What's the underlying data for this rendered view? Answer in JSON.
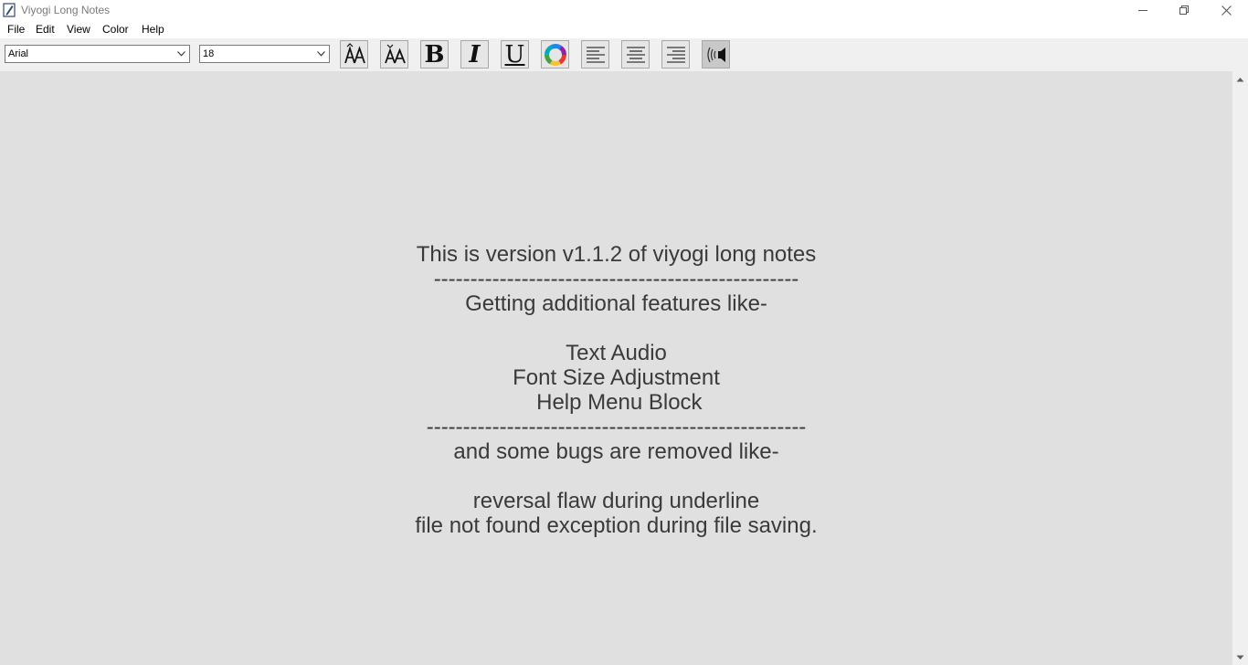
{
  "window": {
    "title": "Viyogi Long Notes"
  },
  "menu": {
    "items": [
      "File",
      "Edit",
      "View",
      "Color",
      "Help"
    ]
  },
  "toolbar": {
    "font_family": {
      "value": "Arial"
    },
    "font_size": {
      "value": "18"
    },
    "buttons": [
      {
        "name": "increase-font-size",
        "icon": "font-size-up-icon"
      },
      {
        "name": "decrease-font-size",
        "icon": "font-size-down-icon"
      },
      {
        "name": "bold",
        "icon": "bold-icon",
        "glyph": "B"
      },
      {
        "name": "italic",
        "icon": "italic-icon",
        "glyph": "I"
      },
      {
        "name": "underline",
        "icon": "underline-icon",
        "glyph": "U"
      },
      {
        "name": "color",
        "icon": "color-wheel-icon"
      },
      {
        "name": "align-left",
        "icon": "align-left-icon"
      },
      {
        "name": "align-center",
        "icon": "align-center-icon"
      },
      {
        "name": "align-right",
        "icon": "align-right-icon"
      },
      {
        "name": "text-audio",
        "icon": "speaker-icon"
      }
    ]
  },
  "editor": {
    "lines": [
      "This is version v1.1.2 of viyogi long notes",
      "--------------------------------------------------",
      "Getting additional features like-",
      "",
      "Text Audio",
      "Font Size Adjustment",
      " Help Menu Block",
      "----------------------------------------------------",
      "and some bugs are removed like-",
      "",
      "reversal flaw during underline",
      "file not found exception during file saving."
    ]
  }
}
